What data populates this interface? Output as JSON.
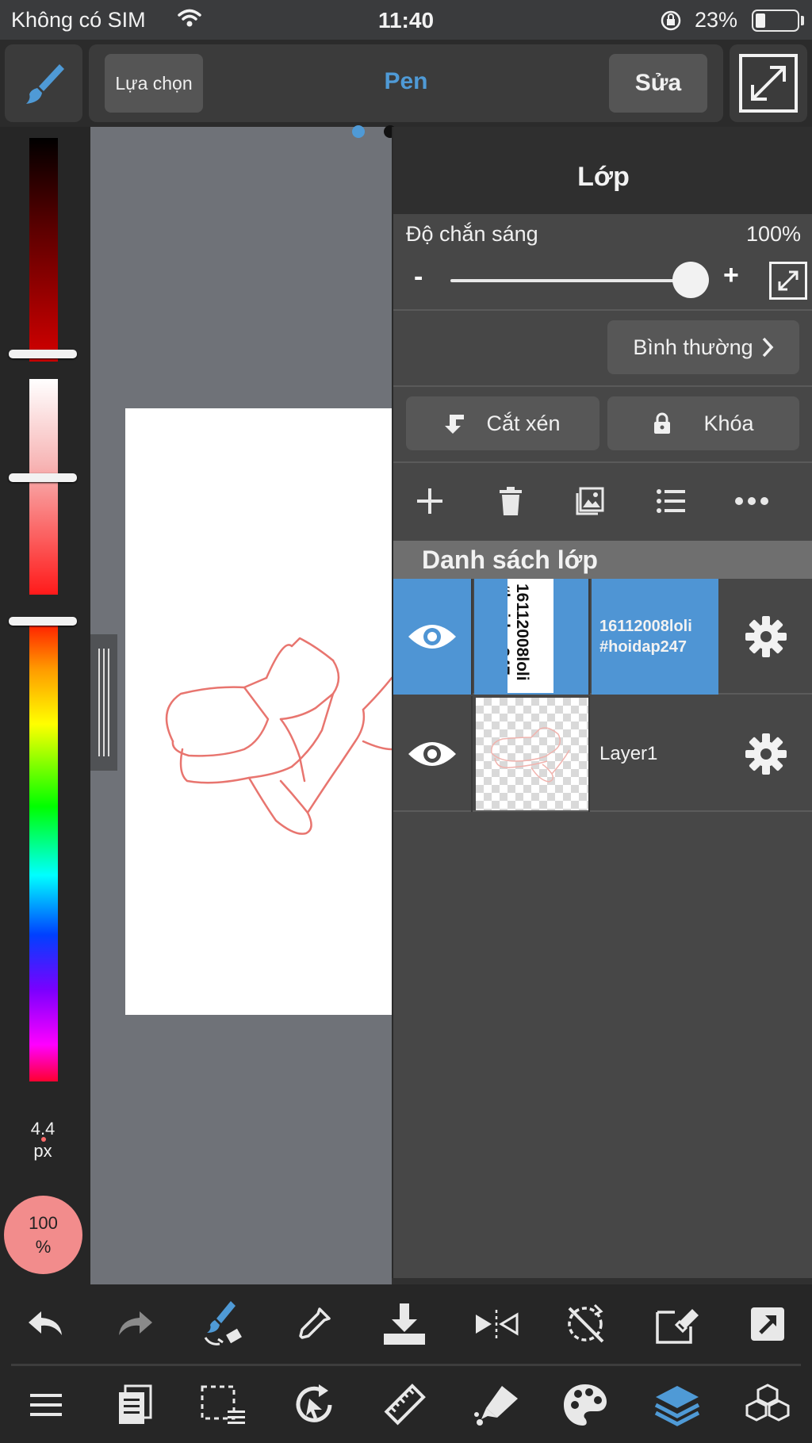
{
  "status_bar": {
    "carrier": "Không có SIM",
    "time": "11:40",
    "battery": "23%"
  },
  "toolbar": {
    "select_label": "Lựa chọn",
    "tool_name": "Pen",
    "edit_label": "Sửa"
  },
  "colors": {
    "accent": "#4f9ad6",
    "active_layer": "#4f95d4",
    "brush_color": "#f28c8c",
    "stroke": "#e8756f"
  },
  "left_panel": {
    "brush_size_value": "4.4",
    "brush_size_unit": "px",
    "brush_opacity_value": "100",
    "brush_opacity_unit": "%"
  },
  "layer_panel": {
    "title": "Lớp",
    "opacity_label": "Độ chắn sáng",
    "opacity_value": "100%",
    "opacity_minus": "-",
    "opacity_plus": "+",
    "blend_mode": "Bình thường",
    "clipping_label": "Cắt xén",
    "lock_label": "Khóa",
    "list_header": "Danh sách lớp",
    "layers": [
      {
        "name_line1": "16112008loli",
        "name_line2": "#hoidap247",
        "active": true
      },
      {
        "name": "Layer1",
        "active": false
      }
    ]
  },
  "icons": {
    "top": [
      "brush-icon",
      "expand-icon"
    ],
    "layer_tools": [
      "add-icon",
      "trash-icon",
      "image-import-icon",
      "list-icon",
      "more-icon"
    ],
    "bottom_row1": [
      "undo-icon",
      "redo-icon",
      "brush-swap-icon",
      "eyedropper-icon",
      "download-icon",
      "flip-icon",
      "no-rotate-icon",
      "eraser-window-icon",
      "share-icon"
    ],
    "bottom_row2": [
      "menu-icon",
      "pages-icon",
      "selection-icon",
      "transform-icon",
      "ruler-icon",
      "fill-icon",
      "palette-icon",
      "layers-icon",
      "materials-icon"
    ]
  }
}
